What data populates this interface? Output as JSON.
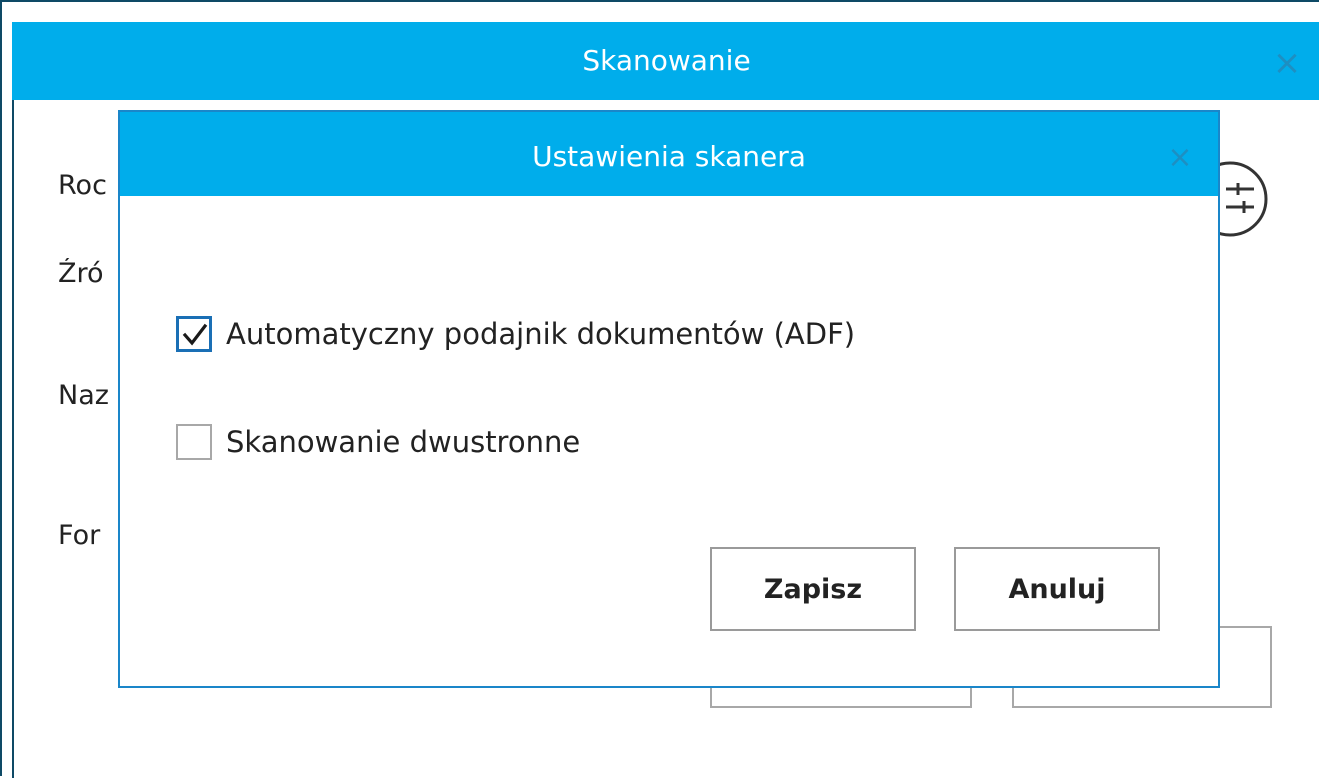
{
  "outer_window": {
    "title": "Skanowanie",
    "close_glyph": "×",
    "background_labels": [
      "Roc",
      "Źró",
      "Naz",
      "For"
    ]
  },
  "dialog": {
    "title": "Ustawienia skanera",
    "close_glyph": "×",
    "options": [
      {
        "label": "Automatyczny podajnik dokumentów (ADF)",
        "checked": true
      },
      {
        "label": "Skanowanie dwustronne",
        "checked": false
      }
    ],
    "buttons": {
      "save_label": "Zapisz",
      "cancel_label": "Anuluj"
    }
  },
  "colors": {
    "titlebar": "#00adeb",
    "accent_border": "#1a86c9",
    "checkbox_checked": "#1a6fb5"
  }
}
